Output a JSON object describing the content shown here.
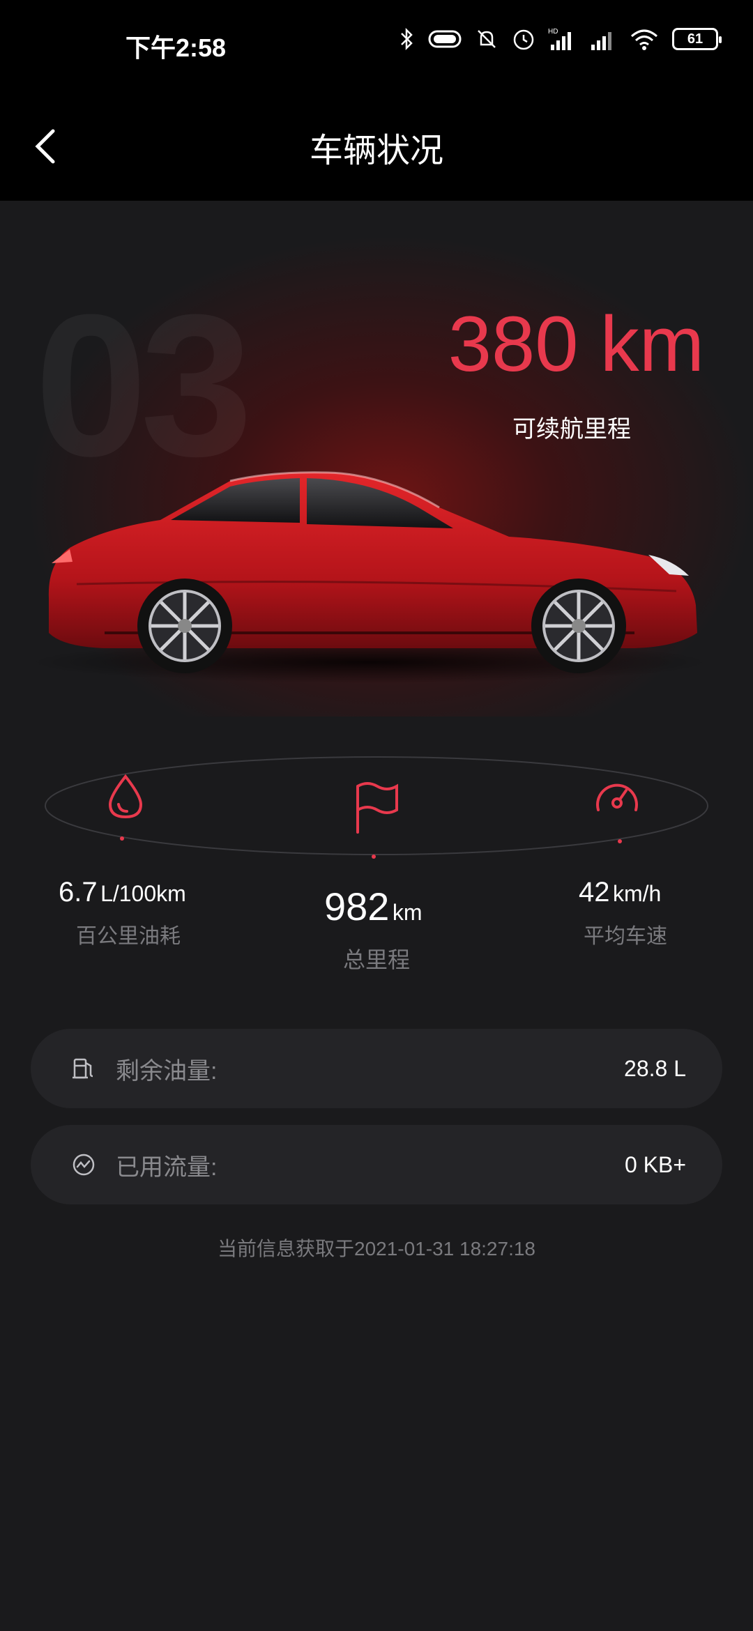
{
  "status_bar": {
    "time": "下午2:58",
    "battery": "61"
  },
  "header": {
    "title": "车辆状况"
  },
  "hero": {
    "model_watermark": "03",
    "range_value": "380 km",
    "range_label": "可续航里程"
  },
  "stats": {
    "fuel_consumption": {
      "value": "6.7",
      "unit": "L/100km",
      "label": "百公里油耗",
      "icon": "droplet-icon"
    },
    "total_mileage": {
      "value": "982",
      "unit": "km",
      "label": "总里程",
      "icon": "flag-icon"
    },
    "average_speed": {
      "value": "42",
      "unit": "km/h",
      "label": "平均车速",
      "icon": "speedometer-icon"
    }
  },
  "cards": [
    {
      "label": "剩余油量:",
      "value": "28.8 L",
      "icon": "fuel-pump-icon"
    },
    {
      "label": "已用流量:",
      "value": "0 KB+",
      "icon": "data-usage-icon"
    }
  ],
  "footer": {
    "timestamp": "当前信息获取于2021-01-31 18:27:18"
  },
  "colors": {
    "accent": "#e8394d",
    "background": "#1a1a1c",
    "card": "#242427",
    "muted": "#7a7a7e"
  }
}
